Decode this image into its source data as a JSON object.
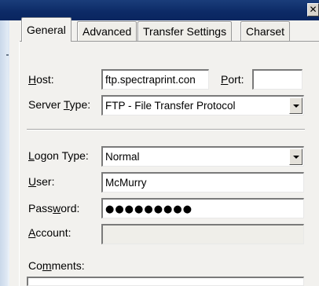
{
  "titlebar": {
    "close_glyph": "✕",
    "close_icon": "close-icon"
  },
  "tabs": [
    {
      "label": "General",
      "active": true
    },
    {
      "label": "Advanced",
      "active": false
    },
    {
      "label": "Transfer Settings",
      "active": false
    },
    {
      "label": "Charset",
      "active": false
    }
  ],
  "form": {
    "host": {
      "label_pre": "",
      "label_key": "H",
      "label_post": "ost:",
      "value": "ftp.spectraprint.con"
    },
    "port": {
      "label_pre": "",
      "label_key": "P",
      "label_post": "ort:",
      "value": ""
    },
    "server_type": {
      "label_pre": "Server ",
      "label_key": "T",
      "label_post": "ype:",
      "value": "FTP - File Transfer Protocol"
    },
    "logon_type": {
      "label_pre": "",
      "label_key": "L",
      "label_post": "ogon Type:",
      "value": "Normal"
    },
    "user": {
      "label_pre": "",
      "label_key": "U",
      "label_post": "ser:",
      "value": "McMurry"
    },
    "password": {
      "label_pre": "Pass",
      "label_key": "w",
      "label_post": "ord:",
      "value": "●●●●●●●●●"
    },
    "account": {
      "label_pre": "",
      "label_key": "A",
      "label_post": "ccount:",
      "value": ""
    },
    "comments": {
      "label_pre": "Co",
      "label_key": "m",
      "label_post": "ments:",
      "value": ""
    }
  }
}
